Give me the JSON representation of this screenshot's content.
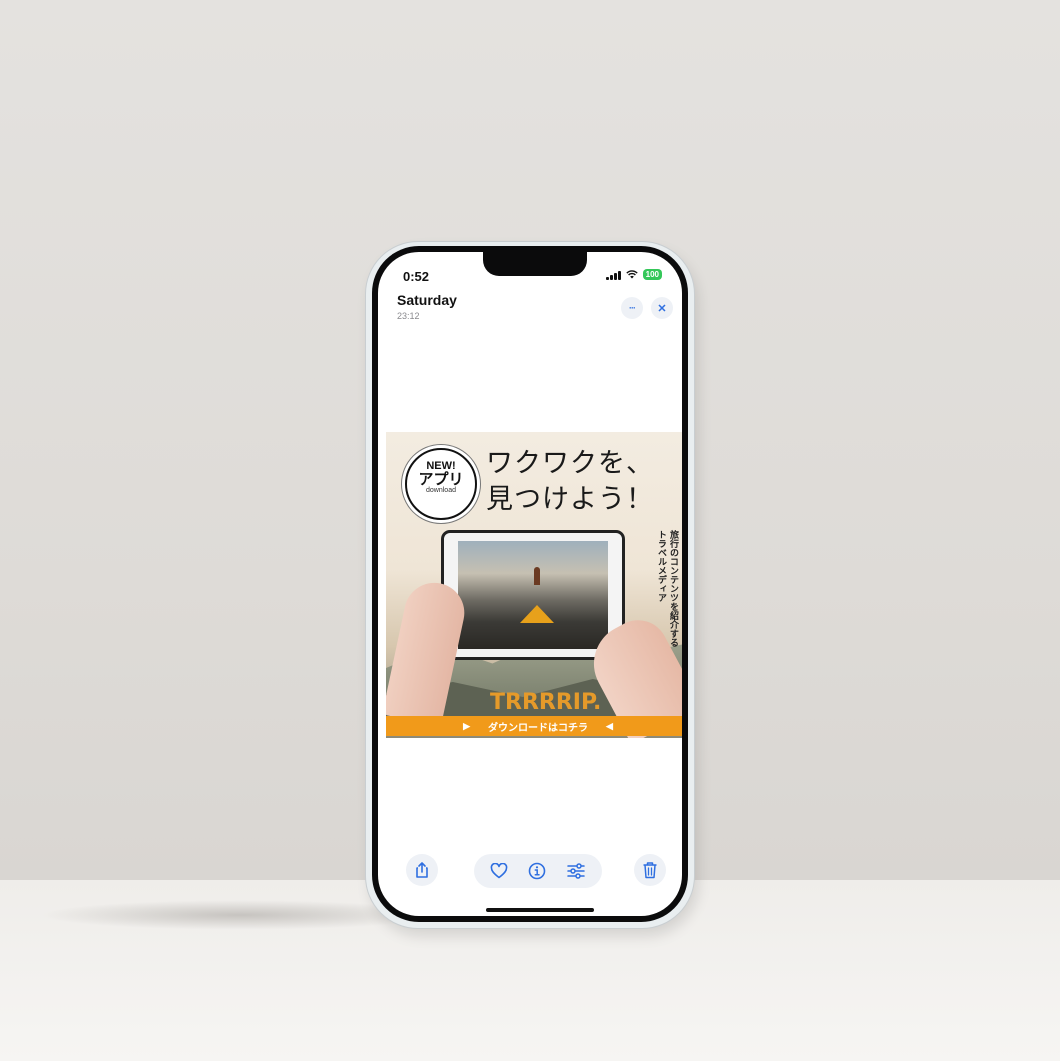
{
  "status_bar": {
    "time": "0:52",
    "battery": "100"
  },
  "header": {
    "title": "Saturday",
    "subtitle": "23:12"
  },
  "header_buttons": {
    "more": "···",
    "close": "✕"
  },
  "ad": {
    "badge_new": "NEW!",
    "badge_app": "アプリ",
    "badge_download": "download",
    "headline_line1": "ワクワクを、",
    "headline_line2": "見つけよう！",
    "vertical_line1": "旅行のコンテンツを紹介する",
    "vertical_line2": "トラベルメディア",
    "brand": "TRRRRIP.",
    "cta": "ダウンロードはコチラ",
    "cta_arrow_left": "▶",
    "cta_arrow_right": "◀"
  },
  "colors": {
    "accent": "#2f6fe0",
    "cta_orange": "#f19a1a",
    "battery_green": "#34c759"
  },
  "toolbar": {
    "share": "share-icon",
    "favorite": "heart-icon",
    "info": "info-icon",
    "adjust": "sliders-icon",
    "delete": "trash-icon"
  }
}
